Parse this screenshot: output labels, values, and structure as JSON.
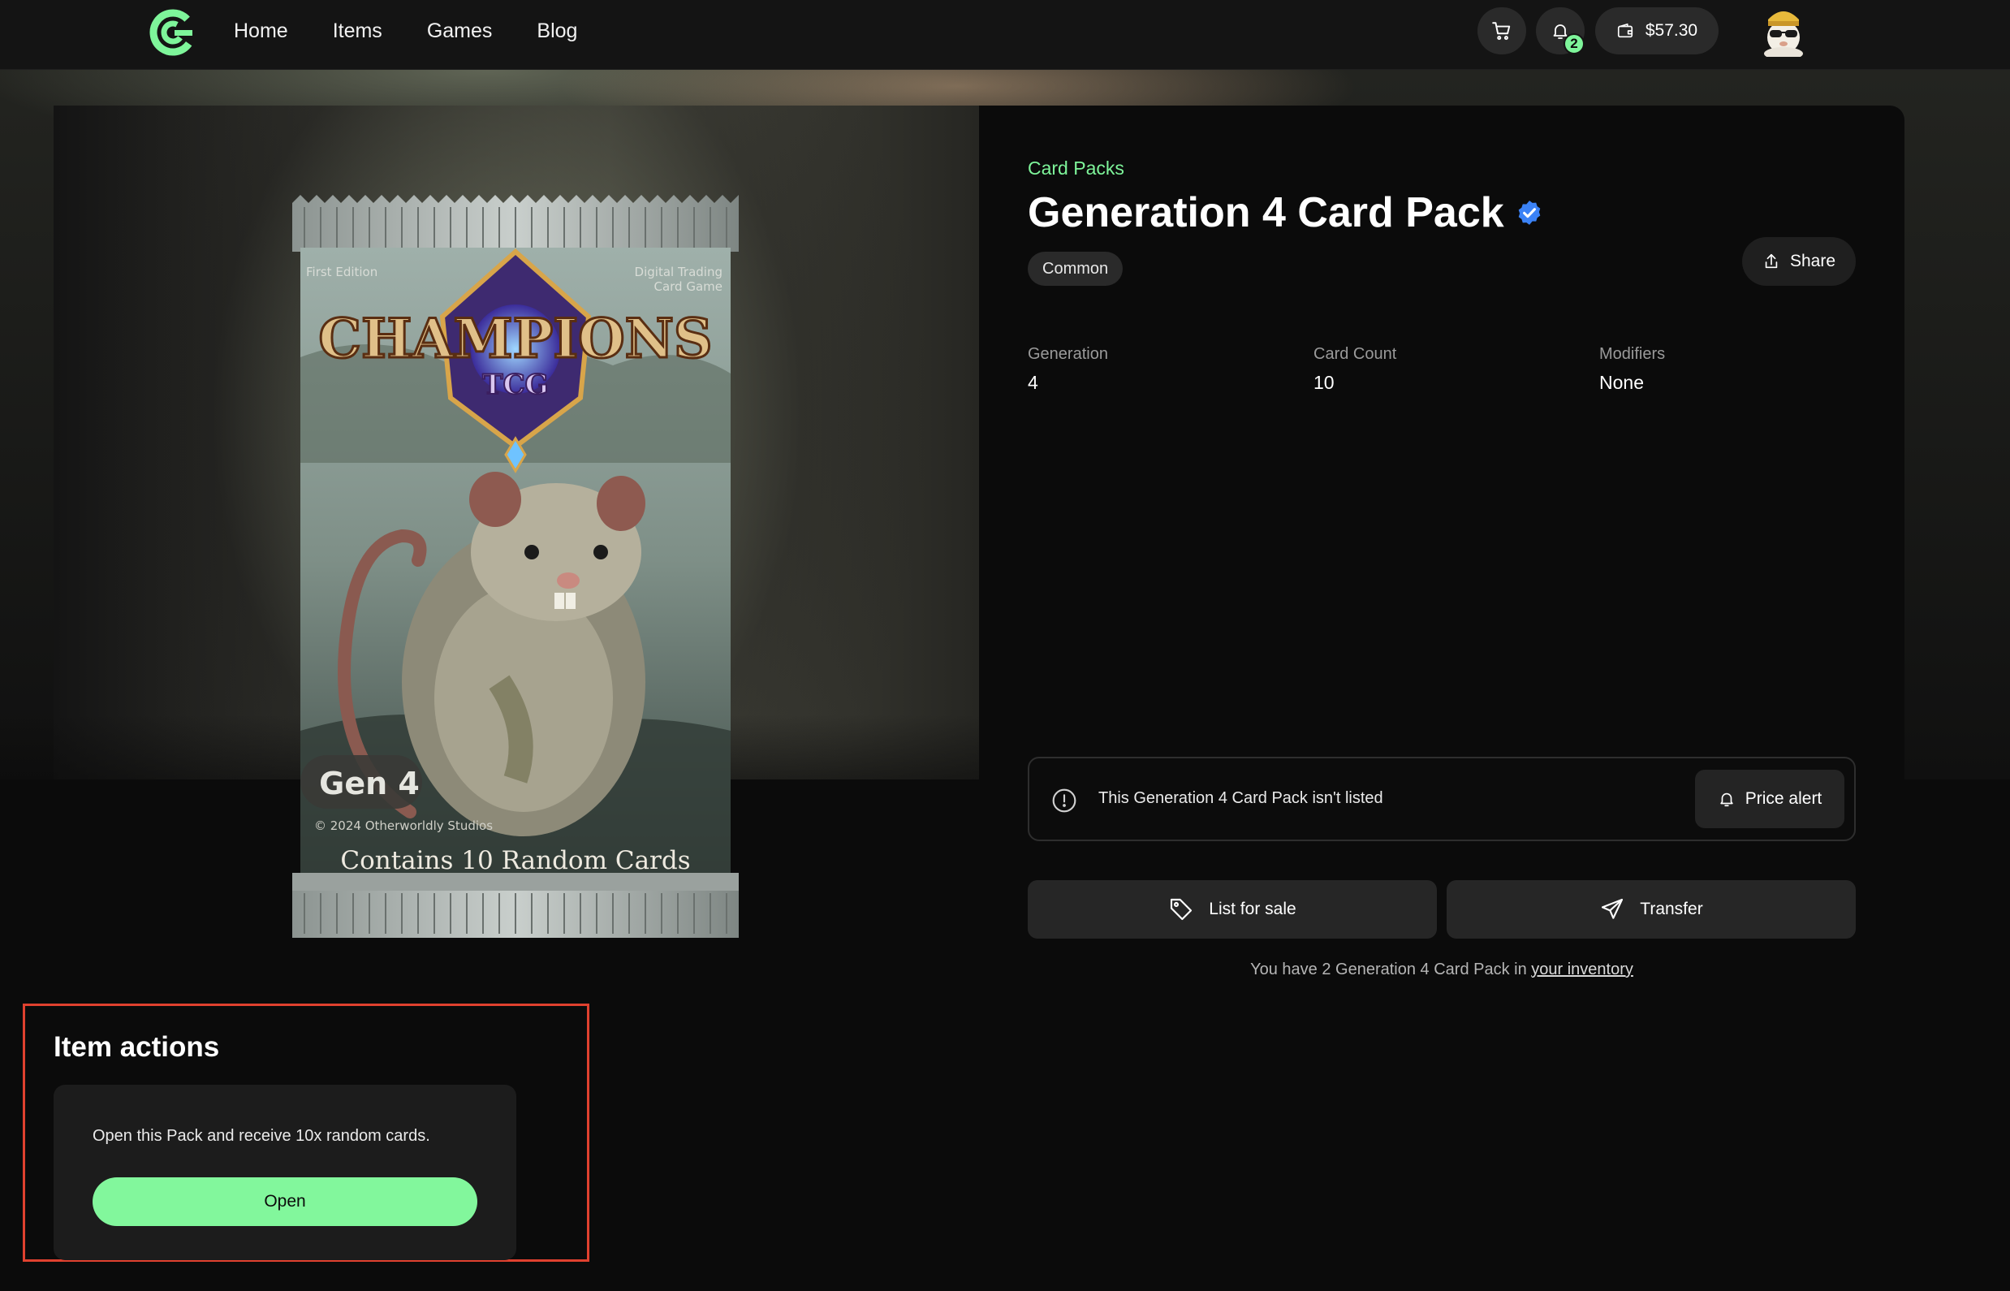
{
  "header": {
    "nav": [
      "Home",
      "Items",
      "Games",
      "Blog"
    ],
    "notifications_count": "2",
    "wallet_balance": "$57.30"
  },
  "item": {
    "category": "Card Packs",
    "title": "Generation 4 Card Pack",
    "rarity": "Common",
    "share_label": "Share",
    "attributes": [
      {
        "label": "Generation",
        "value": "4"
      },
      {
        "label": "Card Count",
        "value": "10"
      },
      {
        "label": "Modifiers",
        "value": "None"
      }
    ],
    "listing_status": "This Generation 4 Card Pack isn't listed",
    "price_alert_label": "Price alert",
    "list_for_sale_label": "List for sale",
    "transfer_label": "Transfer",
    "inventory_note_prefix": "You have 2 Generation 4 Card Pack in ",
    "inventory_link": "your inventory"
  },
  "pack_art": {
    "edition": "First Edition",
    "game_type_line1": "Digital Trading",
    "game_type_line2": "Card Game",
    "logo_main": "CHAMPIONS",
    "logo_sub": "TCG",
    "gen_label": "Gen 4",
    "copyright": "© 2024 Otherworldly Studios",
    "contents": "Contains 10 Random Cards"
  },
  "item_actions": {
    "title": "Item actions",
    "description": "Open this Pack and receive 10x random cards.",
    "open_label": "Open"
  },
  "colors": {
    "accent_green": "#7ef59a",
    "highlight_red": "#e0412f",
    "verified_blue": "#3b82f6"
  }
}
